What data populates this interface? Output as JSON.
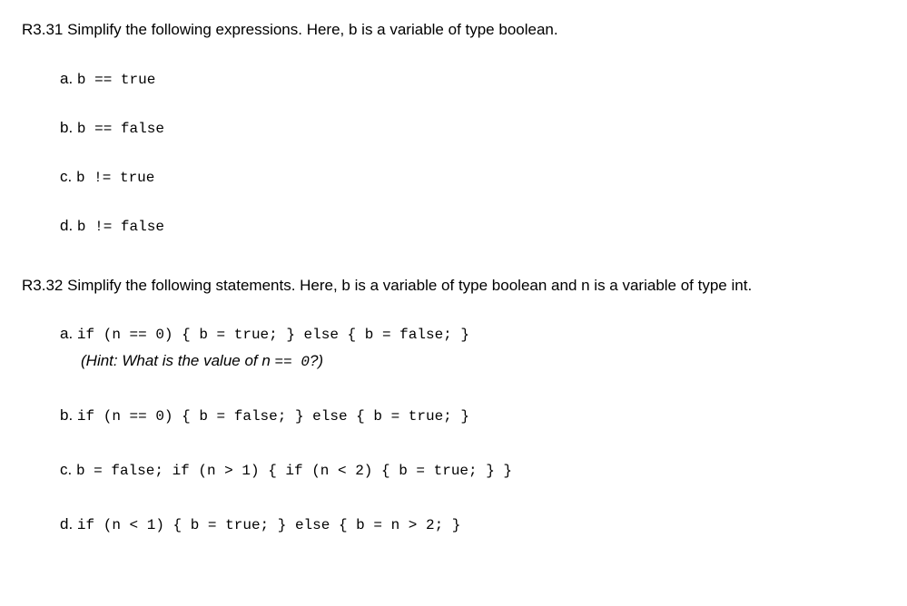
{
  "q1": {
    "prompt": "R3.31 Simplify the following expressions. Here, b is a variable of type boolean.",
    "items": [
      {
        "label": "a. ",
        "code": "b == true"
      },
      {
        "label": "b. ",
        "code": "b == false"
      },
      {
        "label": "c. ",
        "code": "b != true"
      },
      {
        "label": "d. ",
        "code": "b != false"
      }
    ]
  },
  "q2": {
    "prompt": "R3.32 Simplify the following statements. Here, b is a variable of type boolean and n is a variable of type int.",
    "items": [
      {
        "label": "a. ",
        "code": "if (n == 0) { b = true; } else { b = false; }",
        "hint_pre": "(Hint: What is the value of n ",
        "hint_code": "== 0",
        "hint_post": "?)"
      },
      {
        "label": "b. ",
        "code": "if (n == 0) { b = false; } else { b = true; }"
      },
      {
        "label": "c. ",
        "code": "b = false; if (n > 1) { if (n < 2) { b = true; } }"
      },
      {
        "label": "d. ",
        "code": "if (n < 1) { b = true; } else { b = n > 2; }"
      }
    ]
  }
}
